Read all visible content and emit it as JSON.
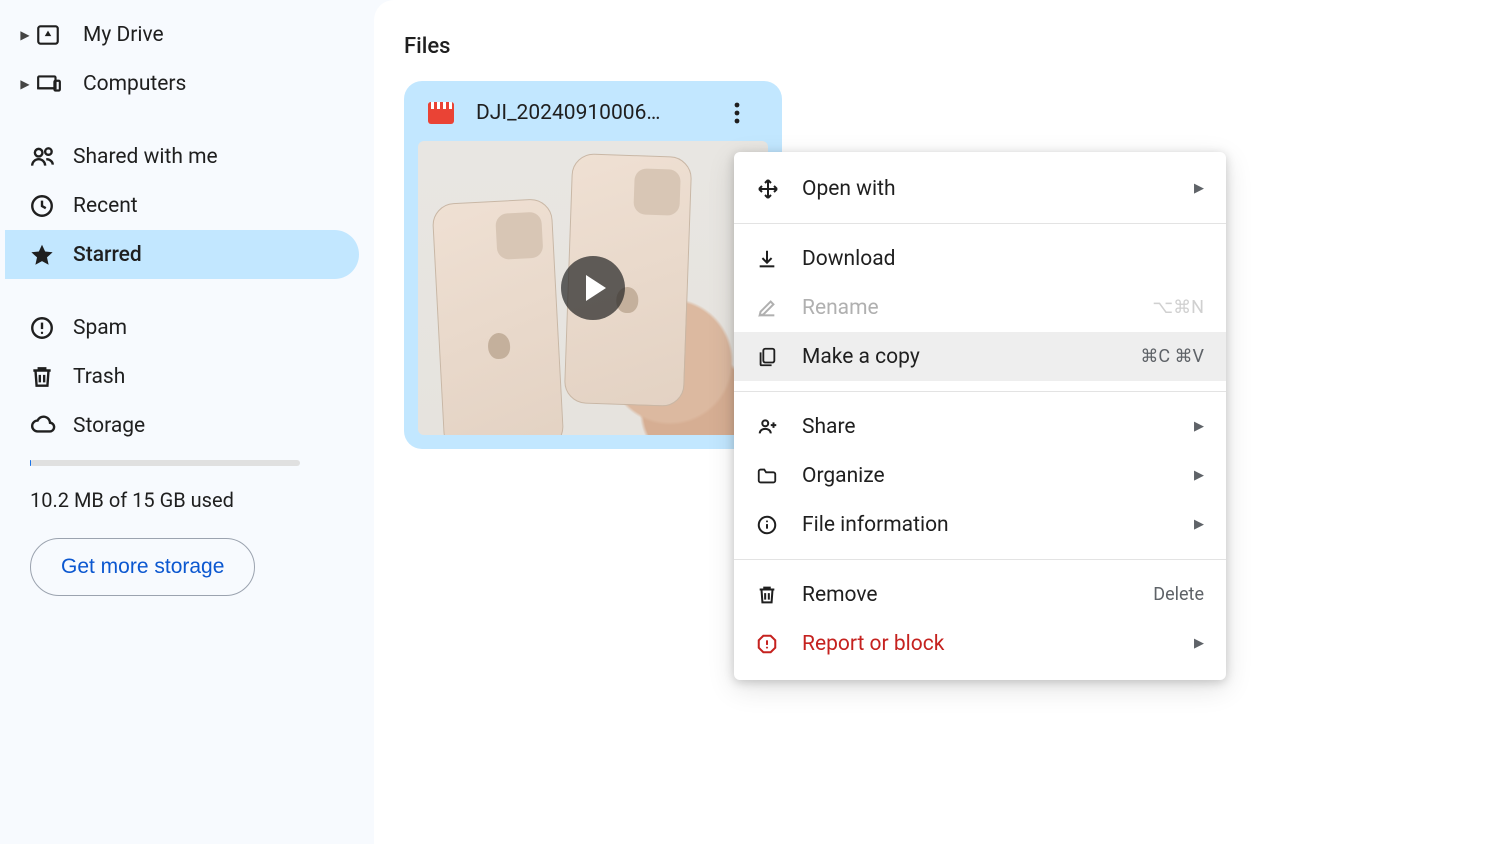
{
  "sidebar": {
    "items": [
      {
        "label": "My Drive"
      },
      {
        "label": "Computers"
      },
      {
        "label": "Shared with me"
      },
      {
        "label": "Recent"
      },
      {
        "label": "Starred"
      },
      {
        "label": "Spam"
      },
      {
        "label": "Trash"
      },
      {
        "label": "Storage"
      }
    ],
    "storage_used_text": "10.2 MB of 15 GB used",
    "get_more_label": "Get more storage"
  },
  "main": {
    "section_title": "Files",
    "file": {
      "name": "DJI_20240910006…"
    }
  },
  "context_menu": {
    "open_with": "Open with",
    "download": "Download",
    "rename": "Rename",
    "rename_shortcut": "⌥⌘N",
    "make_a_copy": "Make a copy",
    "make_a_copy_shortcut": "⌘C ⌘V",
    "share": "Share",
    "organize": "Organize",
    "file_information": "File information",
    "remove": "Remove",
    "remove_shortcut": "Delete",
    "report_or_block": "Report or block"
  }
}
